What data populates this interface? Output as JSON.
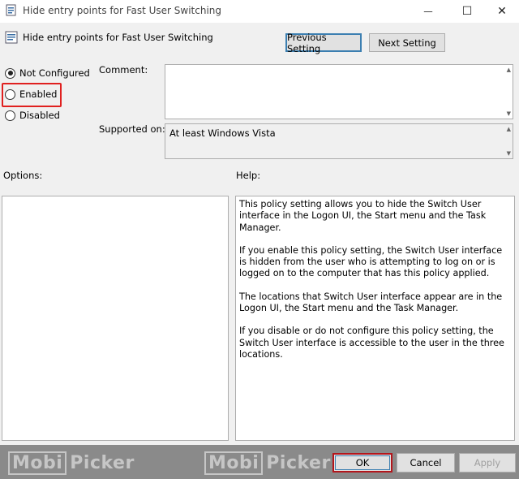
{
  "window": {
    "title": "Hide entry points for Fast User Switching",
    "minimize_glyph": "—",
    "maximize_glyph": "☐",
    "close_glyph": "✕"
  },
  "header": {
    "policy_name": "Hide entry points for Fast User Switching",
    "previous_label": "Previous Setting",
    "next_label": "Next Setting"
  },
  "state": {
    "options": [
      {
        "label": "Not Configured",
        "selected": true
      },
      {
        "label": "Enabled",
        "selected": false,
        "highlighted": true
      },
      {
        "label": "Disabled",
        "selected": false
      }
    ]
  },
  "fields": {
    "comment_label": "Comment:",
    "comment_value": "",
    "supported_label": "Supported on:",
    "supported_value": "At least Windows Vista"
  },
  "sections": {
    "options_label": "Options:",
    "help_label": "Help:"
  },
  "help_text": [
    "This policy setting allows you to hide the Switch User interface in the Logon UI, the Start menu and the Task Manager.",
    "If you enable this policy setting, the Switch User interface is hidden from the user who is attempting to log on or is logged on to the computer that has this policy applied.",
    "The locations that Switch User interface appear are in the Logon UI, the Start menu and the Task Manager.",
    "If you disable or do not configure this policy setting, the Switch User interface is accessible to the user in the three locations."
  ],
  "footer": {
    "ok_label": "OK",
    "cancel_label": "Cancel",
    "apply_label": "Apply",
    "watermark_box": "Mobi",
    "watermark_text": "Picker"
  },
  "colors": {
    "highlight_red": "#e0201f",
    "focus_blue": "#3c7fb1",
    "ok_red": "#b3161c"
  }
}
